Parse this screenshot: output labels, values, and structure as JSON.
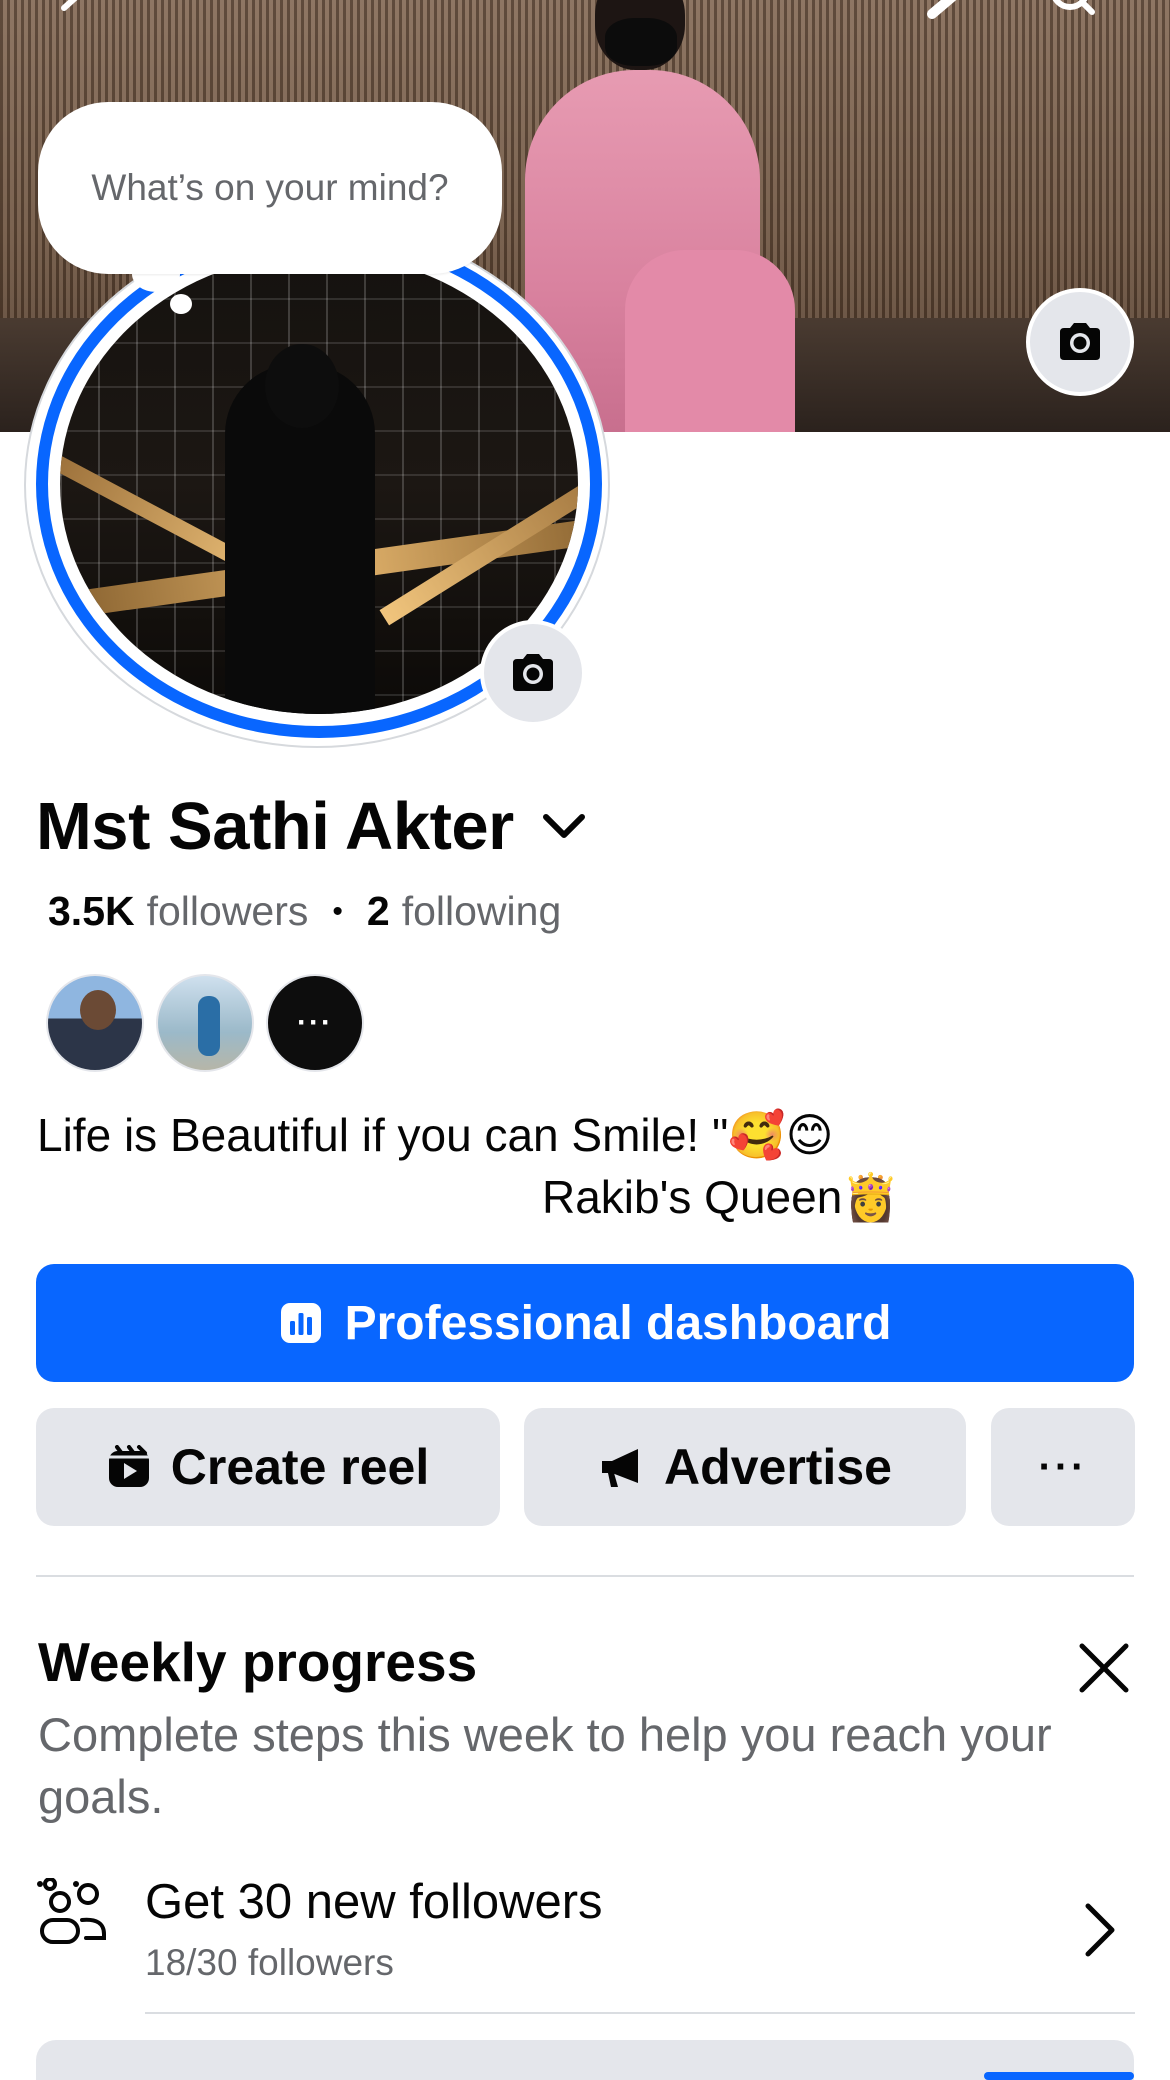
{
  "composer": {
    "placeholder": "What’s on your mind?"
  },
  "profile": {
    "name": "Mst Sathi Akter",
    "followers_count": "3.5K",
    "followers_label": "followers",
    "separator": "•",
    "following_count": "2",
    "following_label": "following",
    "more_friends_label": "···",
    "bio_line1": "Life is Beautiful if you can Smile! \"🥰😊",
    "bio_line2": "Rakib's Queen👸"
  },
  "actions": {
    "primary_label": "Professional dashboard",
    "create_reel_label": "Create reel",
    "advertise_label": "Advertise",
    "more_label": "···"
  },
  "weekly_progress": {
    "title": "Weekly progress",
    "description": "Complete steps this week to help you reach your goals.",
    "goal": {
      "title": "Get 30 new followers",
      "progress_text": "18/30 followers",
      "current": 18,
      "target": 30
    }
  },
  "colors": {
    "brand_blue": "#0866ff",
    "secondary_button": "#e4e6eb",
    "text_primary": "#050505",
    "text_secondary": "#65676b"
  },
  "icons": {
    "top_left": "back-arrow-icon",
    "top_right": [
      "edit-pencil-icon",
      "search-icon"
    ],
    "cover_camera": "camera-icon",
    "avatar_camera": "camera-icon",
    "name_dropdown": "chevron-down-icon",
    "dashboard": "bar-chart-icon",
    "reel": "reel-icon",
    "advertise": "megaphone-icon",
    "close": "close-icon",
    "goal": "people-group-icon",
    "goal_arrow": "chevron-right-icon"
  }
}
